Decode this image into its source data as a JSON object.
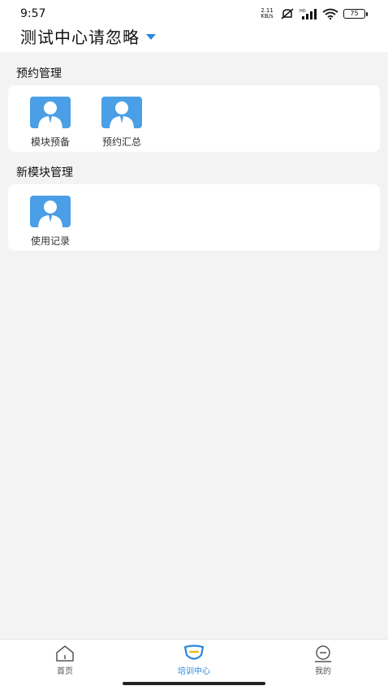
{
  "status_bar": {
    "time": "9:57",
    "net_speed_value": "2.11",
    "net_speed_unit": "KB/s",
    "battery": "75"
  },
  "header": {
    "title": "测试中心请忽略",
    "accent_color": "#2a86e0"
  },
  "sections": [
    {
      "title": "预约管理",
      "items": [
        {
          "label": "模块预备",
          "icon": "user-avatar-icon"
        },
        {
          "label": "预约汇总",
          "icon": "user-avatar-icon"
        }
      ]
    },
    {
      "title": "新模块管理",
      "items": [
        {
          "label": "使用记录",
          "icon": "user-avatar-icon"
        }
      ]
    }
  ],
  "bottom_nav": {
    "items": [
      {
        "label": "首页",
        "icon": "home-icon",
        "active": false
      },
      {
        "label": "培训中心",
        "icon": "training-center-icon",
        "active": true
      },
      {
        "label": "我的",
        "icon": "profile-icon",
        "active": false
      }
    ]
  }
}
